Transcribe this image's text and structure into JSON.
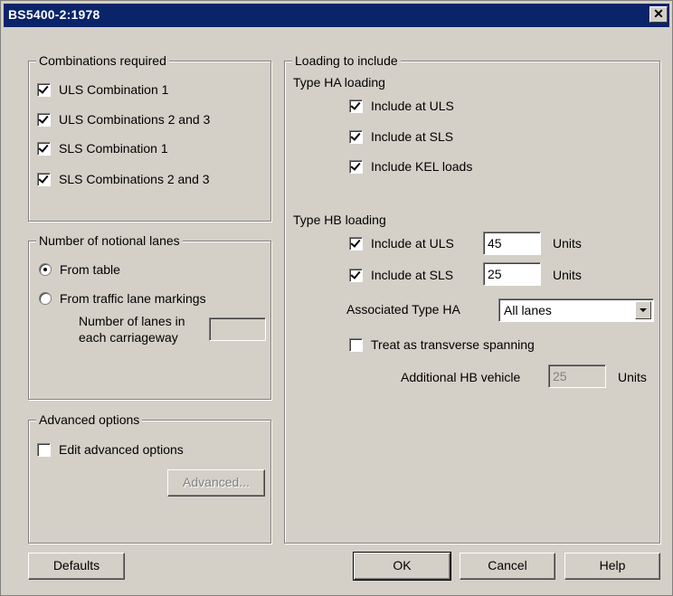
{
  "window": {
    "title": "BS5400-2:1978",
    "close_glyph": "✕"
  },
  "combinations": {
    "legend": "Combinations required",
    "items": [
      {
        "label": "ULS Combination 1",
        "checked": true
      },
      {
        "label": "ULS Combinations 2 and 3",
        "checked": true
      },
      {
        "label": "SLS Combination 1",
        "checked": true
      },
      {
        "label": "SLS Combinations 2 and 3",
        "checked": true
      }
    ]
  },
  "lanes": {
    "legend": "Number of notional lanes",
    "from_table": "From table",
    "from_markings": "From traffic lane markings",
    "selected": "From table",
    "lanes_label_1": "Number of lanes in",
    "lanes_label_2": "each carriageway",
    "lanes_value": ""
  },
  "advanced": {
    "legend": "Advanced options",
    "edit_label": "Edit advanced options",
    "edit_checked": false,
    "button_label": "Advanced..."
  },
  "loading": {
    "legend": "Loading to include",
    "ha": {
      "heading": "Type HA loading",
      "uls_label": "Include at ULS",
      "sls_label": "Include at SLS",
      "kel_label": "Include KEL loads"
    },
    "hb": {
      "heading": "Type HB loading",
      "uls_label": "Include at ULS",
      "uls_value": "45",
      "sls_label": "Include at SLS",
      "sls_value": "25",
      "units": "Units",
      "associated_label": "Associated Type HA",
      "associated_value": "All lanes",
      "transverse_label": "Treat as transverse spanning",
      "transverse_checked": false,
      "vehicle_label": "Additional HB vehicle",
      "vehicle_value": "25"
    }
  },
  "buttons": {
    "defaults": "Defaults",
    "ok": "OK",
    "cancel": "Cancel",
    "help": "Help"
  },
  "colors": {
    "titlebar": "#0a246a",
    "face": "#d4d0c8",
    "disabled_text": "#808080"
  }
}
